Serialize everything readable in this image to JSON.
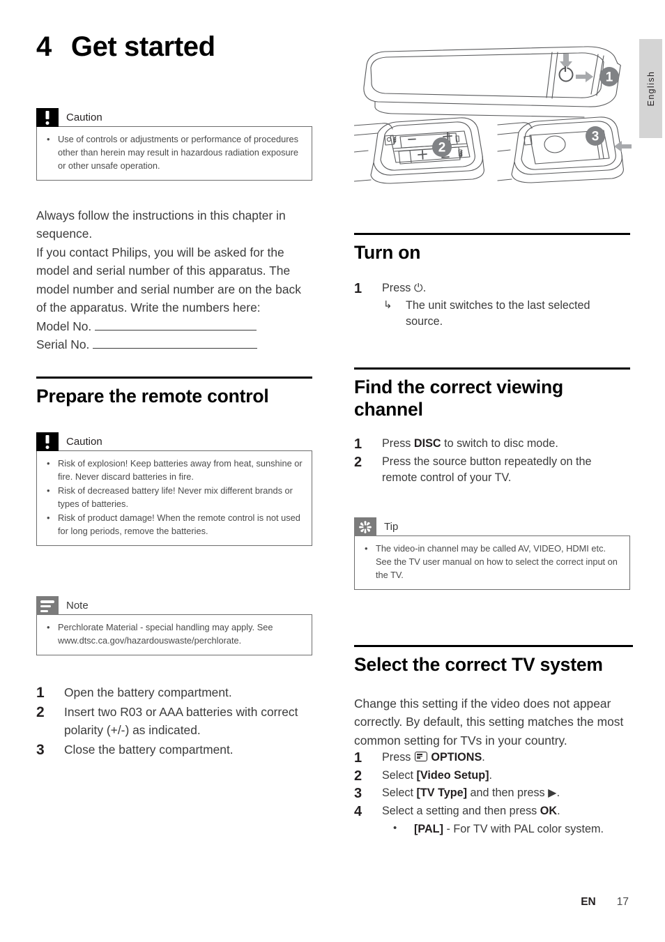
{
  "language_tab": "English",
  "chapter": {
    "number": "4",
    "title": "Get started"
  },
  "footer": {
    "lang_code": "EN",
    "page_number": "17"
  },
  "left_column": {
    "caution_top": {
      "label": "Caution",
      "icon": "exclamation-icon",
      "bullets": [
        "Use of controls or adjustments or performance of procedures other than herein may result in hazardous radiation exposure or other unsafe operation."
      ]
    },
    "intro_paragraph_1": "Always follow the instructions in this chapter in sequence.",
    "intro_paragraph_2": "If you contact Philips, you will be asked for the model and serial number of this apparatus. The model number and serial number are on the back of the apparatus. Write the numbers here:",
    "model_no_label": "Model No.",
    "serial_no_label": "Serial No.",
    "section_prepare_remote": "Prepare the remote control",
    "caution_battery": {
      "label": "Caution",
      "icon": "exclamation-icon",
      "bullets": [
        "Risk of explosion! Keep batteries away from heat, sunshine or fire. Never discard batteries in fire.",
        "Risk of decreased battery life! Never mix different brands or types of batteries.",
        "Risk of product damage! When the remote control is not used for long periods, remove the batteries."
      ]
    },
    "note_perchlorate": {
      "label": "Note",
      "icon": "note-lines-icon",
      "bullets": [
        "Perchlorate Material - special handling may apply. See www.dtsc.ca.gov/hazardouswaste/perchlorate."
      ]
    },
    "battery_steps": [
      "Open the battery compartment.",
      "Insert two R03 or AAA batteries with correct polarity (+/-) as indicated.",
      "Close the battery compartment."
    ]
  },
  "right_column": {
    "illustration": {
      "name": "remote-control-battery-diagram",
      "callout_numbers": [
        "1",
        "2",
        "3"
      ],
      "battery_polarity_marks": [
        "+",
        "-",
        "+",
        "-"
      ]
    },
    "section_turn_on": "Turn on",
    "turn_on_step_1_prefix": "Press",
    "turn_on_step_1_symbol": "⏻",
    "turn_on_step_1_suffix": ".",
    "turn_on_result": "The unit switches to the last selected source.",
    "section_find_channel": "Find the correct viewing channel",
    "find_channel_step_1": {
      "pre": "Press ",
      "kw": "DISC",
      "post": " to switch to disc mode."
    },
    "find_channel_step_2": "Press the source button repeatedly on the remote control of your TV.",
    "tip_video_in": {
      "label": "Tip",
      "icon": "sparkle-icon",
      "bullets": [
        "The video-in channel may be called AV, VIDEO, HDMI etc. See the TV user manual on how to select the correct input on the TV."
      ]
    },
    "section_tv_system": "Select the correct TV system",
    "tv_system_intro": "Change this setting if the video does not appear correctly. By default, this setting matches the most common setting for TVs in your country.",
    "tv_steps": {
      "step1": {
        "pre": "Press ",
        "icon": "options-icon",
        "kw": "OPTIONS",
        "post": "."
      },
      "step2": {
        "pre": "Select ",
        "kw": "[Video Setup]",
        "post": "."
      },
      "step3": {
        "pre": "Select ",
        "kw": "[TV Type]",
        "post": " and then press ▶."
      },
      "step4": {
        "pre": "Select a setting and then press ",
        "kw": "OK",
        "post": "."
      },
      "step4_bullet": {
        "kw": "[PAL]",
        "post": " - For TV with PAL color system."
      }
    }
  }
}
